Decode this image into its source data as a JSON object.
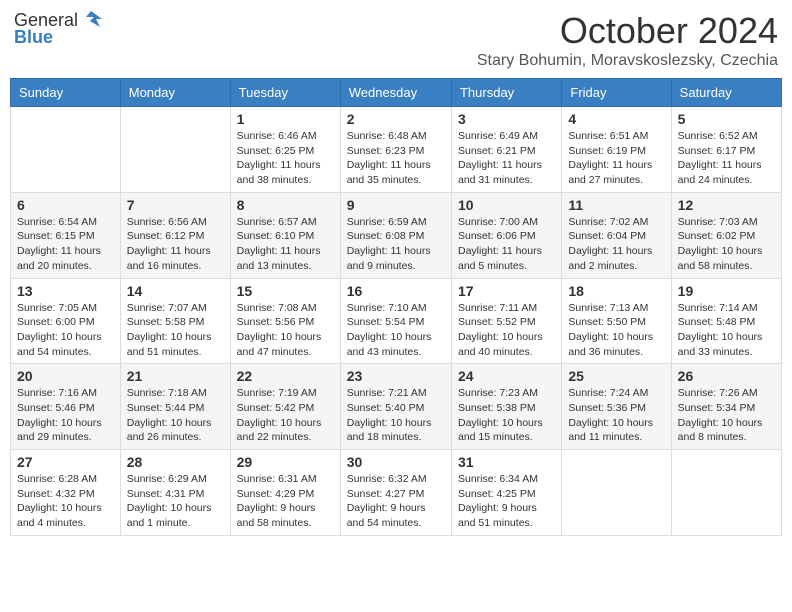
{
  "logo": {
    "general": "General",
    "blue": "Blue"
  },
  "title": {
    "month_year": "October 2024",
    "location": "Stary Bohumin, Moravskoslezsky, Czechia"
  },
  "headers": [
    "Sunday",
    "Monday",
    "Tuesday",
    "Wednesday",
    "Thursday",
    "Friday",
    "Saturday"
  ],
  "weeks": [
    [
      {
        "day": "",
        "info": ""
      },
      {
        "day": "",
        "info": ""
      },
      {
        "day": "1",
        "info": "Sunrise: 6:46 AM\nSunset: 6:25 PM\nDaylight: 11 hours and 38 minutes."
      },
      {
        "day": "2",
        "info": "Sunrise: 6:48 AM\nSunset: 6:23 PM\nDaylight: 11 hours and 35 minutes."
      },
      {
        "day": "3",
        "info": "Sunrise: 6:49 AM\nSunset: 6:21 PM\nDaylight: 11 hours and 31 minutes."
      },
      {
        "day": "4",
        "info": "Sunrise: 6:51 AM\nSunset: 6:19 PM\nDaylight: 11 hours and 27 minutes."
      },
      {
        "day": "5",
        "info": "Sunrise: 6:52 AM\nSunset: 6:17 PM\nDaylight: 11 hours and 24 minutes."
      }
    ],
    [
      {
        "day": "6",
        "info": "Sunrise: 6:54 AM\nSunset: 6:15 PM\nDaylight: 11 hours and 20 minutes."
      },
      {
        "day": "7",
        "info": "Sunrise: 6:56 AM\nSunset: 6:12 PM\nDaylight: 11 hours and 16 minutes."
      },
      {
        "day": "8",
        "info": "Sunrise: 6:57 AM\nSunset: 6:10 PM\nDaylight: 11 hours and 13 minutes."
      },
      {
        "day": "9",
        "info": "Sunrise: 6:59 AM\nSunset: 6:08 PM\nDaylight: 11 hours and 9 minutes."
      },
      {
        "day": "10",
        "info": "Sunrise: 7:00 AM\nSunset: 6:06 PM\nDaylight: 11 hours and 5 minutes."
      },
      {
        "day": "11",
        "info": "Sunrise: 7:02 AM\nSunset: 6:04 PM\nDaylight: 11 hours and 2 minutes."
      },
      {
        "day": "12",
        "info": "Sunrise: 7:03 AM\nSunset: 6:02 PM\nDaylight: 10 hours and 58 minutes."
      }
    ],
    [
      {
        "day": "13",
        "info": "Sunrise: 7:05 AM\nSunset: 6:00 PM\nDaylight: 10 hours and 54 minutes."
      },
      {
        "day": "14",
        "info": "Sunrise: 7:07 AM\nSunset: 5:58 PM\nDaylight: 10 hours and 51 minutes."
      },
      {
        "day": "15",
        "info": "Sunrise: 7:08 AM\nSunset: 5:56 PM\nDaylight: 10 hours and 47 minutes."
      },
      {
        "day": "16",
        "info": "Sunrise: 7:10 AM\nSunset: 5:54 PM\nDaylight: 10 hours and 43 minutes."
      },
      {
        "day": "17",
        "info": "Sunrise: 7:11 AM\nSunset: 5:52 PM\nDaylight: 10 hours and 40 minutes."
      },
      {
        "day": "18",
        "info": "Sunrise: 7:13 AM\nSunset: 5:50 PM\nDaylight: 10 hours and 36 minutes."
      },
      {
        "day": "19",
        "info": "Sunrise: 7:14 AM\nSunset: 5:48 PM\nDaylight: 10 hours and 33 minutes."
      }
    ],
    [
      {
        "day": "20",
        "info": "Sunrise: 7:16 AM\nSunset: 5:46 PM\nDaylight: 10 hours and 29 minutes."
      },
      {
        "day": "21",
        "info": "Sunrise: 7:18 AM\nSunset: 5:44 PM\nDaylight: 10 hours and 26 minutes."
      },
      {
        "day": "22",
        "info": "Sunrise: 7:19 AM\nSunset: 5:42 PM\nDaylight: 10 hours and 22 minutes."
      },
      {
        "day": "23",
        "info": "Sunrise: 7:21 AM\nSunset: 5:40 PM\nDaylight: 10 hours and 18 minutes."
      },
      {
        "day": "24",
        "info": "Sunrise: 7:23 AM\nSunset: 5:38 PM\nDaylight: 10 hours and 15 minutes."
      },
      {
        "day": "25",
        "info": "Sunrise: 7:24 AM\nSunset: 5:36 PM\nDaylight: 10 hours and 11 minutes."
      },
      {
        "day": "26",
        "info": "Sunrise: 7:26 AM\nSunset: 5:34 PM\nDaylight: 10 hours and 8 minutes."
      }
    ],
    [
      {
        "day": "27",
        "info": "Sunrise: 6:28 AM\nSunset: 4:32 PM\nDaylight: 10 hours and 4 minutes."
      },
      {
        "day": "28",
        "info": "Sunrise: 6:29 AM\nSunset: 4:31 PM\nDaylight: 10 hours and 1 minute."
      },
      {
        "day": "29",
        "info": "Sunrise: 6:31 AM\nSunset: 4:29 PM\nDaylight: 9 hours and 58 minutes."
      },
      {
        "day": "30",
        "info": "Sunrise: 6:32 AM\nSunset: 4:27 PM\nDaylight: 9 hours and 54 minutes."
      },
      {
        "day": "31",
        "info": "Sunrise: 6:34 AM\nSunset: 4:25 PM\nDaylight: 9 hours and 51 minutes."
      },
      {
        "day": "",
        "info": ""
      },
      {
        "day": "",
        "info": ""
      }
    ]
  ]
}
